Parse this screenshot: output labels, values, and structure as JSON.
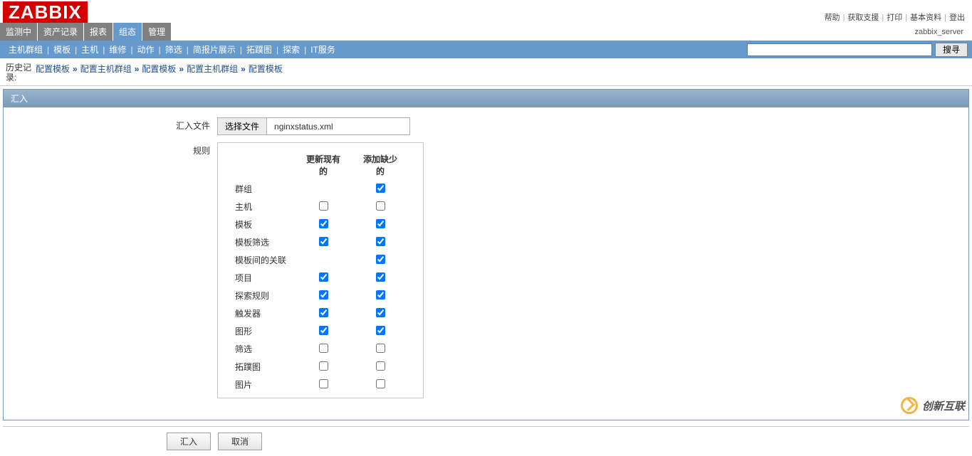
{
  "logo": "ZABBIX",
  "top_links": [
    "帮助",
    "获取支援",
    "打印",
    "基本资料",
    "登出"
  ],
  "server_label": "zabbix_server",
  "nav1": [
    {
      "label": "监测中",
      "active": false
    },
    {
      "label": "资产记录",
      "active": false
    },
    {
      "label": "报表",
      "active": false
    },
    {
      "label": "组态",
      "active": true
    },
    {
      "label": "管理",
      "active": false
    }
  ],
  "nav2": [
    "主机群组",
    "模板",
    "主机",
    "维修",
    "动作",
    "筛选",
    "简报片展示",
    "拓蹼图",
    "探索",
    "IT服务"
  ],
  "search_button": "搜寻",
  "history_label": "历史记录:",
  "breadcrumb": [
    "配置模板",
    "配置主机群组",
    "配置模板",
    "配置主机群组",
    "配置模板"
  ],
  "panel_title": "汇入",
  "form": {
    "file_label": "汇入文件",
    "file_button": "选择文件",
    "file_name": "nginxstatus.xml",
    "rules_label": "规则",
    "rules_cols": [
      "",
      "更新现有的",
      "添加缺少的"
    ],
    "rules_rows": [
      {
        "name": "群组",
        "upd": false,
        "add": true,
        "upd_show": false
      },
      {
        "name": "主机",
        "upd": false,
        "add": false,
        "upd_show": true
      },
      {
        "name": "模板",
        "upd": true,
        "add": true,
        "upd_show": true
      },
      {
        "name": "模板筛选",
        "upd": true,
        "add": true,
        "upd_show": true
      },
      {
        "name": "模板间的关联",
        "upd": false,
        "add": true,
        "upd_show": false
      },
      {
        "name": "项目",
        "upd": true,
        "add": true,
        "upd_show": true
      },
      {
        "name": "探索规则",
        "upd": true,
        "add": true,
        "upd_show": true
      },
      {
        "name": "触发器",
        "upd": true,
        "add": true,
        "upd_show": true
      },
      {
        "name": "图形",
        "upd": true,
        "add": true,
        "upd_show": true
      },
      {
        "name": "筛选",
        "upd": false,
        "add": false,
        "upd_show": true
      },
      {
        "name": "拓蹼图",
        "upd": false,
        "add": false,
        "upd_show": true
      },
      {
        "name": "图片",
        "upd": false,
        "add": false,
        "upd_show": true
      }
    ]
  },
  "buttons": {
    "import": "汇入",
    "cancel": "取消"
  },
  "watermark": "创新互联"
}
